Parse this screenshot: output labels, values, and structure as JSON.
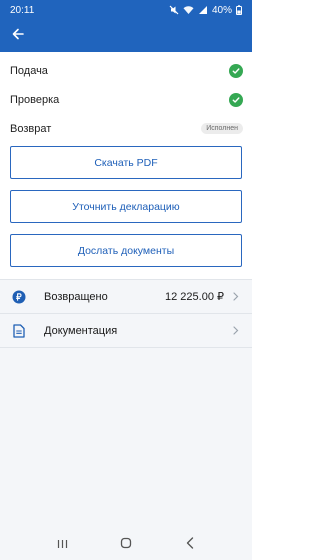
{
  "status_bar": {
    "time": "20:11",
    "battery": "40%"
  },
  "app_bar": {
    "back_icon": "arrow-left-icon"
  },
  "steps": [
    {
      "label": "Подача",
      "state": "done"
    },
    {
      "label": "Проверка",
      "state": "done"
    },
    {
      "label": "Возврат",
      "badge": "Исполнен"
    }
  ],
  "buttons": {
    "download": "Скачать PDF",
    "clarify": "Уточнить декларацию",
    "send_docs": "Дослать документы"
  },
  "list": [
    {
      "icon": "ruble-coin-icon",
      "label": "Возвращено",
      "value": "12 225.00 ₽"
    },
    {
      "icon": "document-icon",
      "label": "Документация"
    }
  ],
  "colors": {
    "primary": "#2064bd",
    "success": "#35a853",
    "background": "#f4f6f9"
  }
}
